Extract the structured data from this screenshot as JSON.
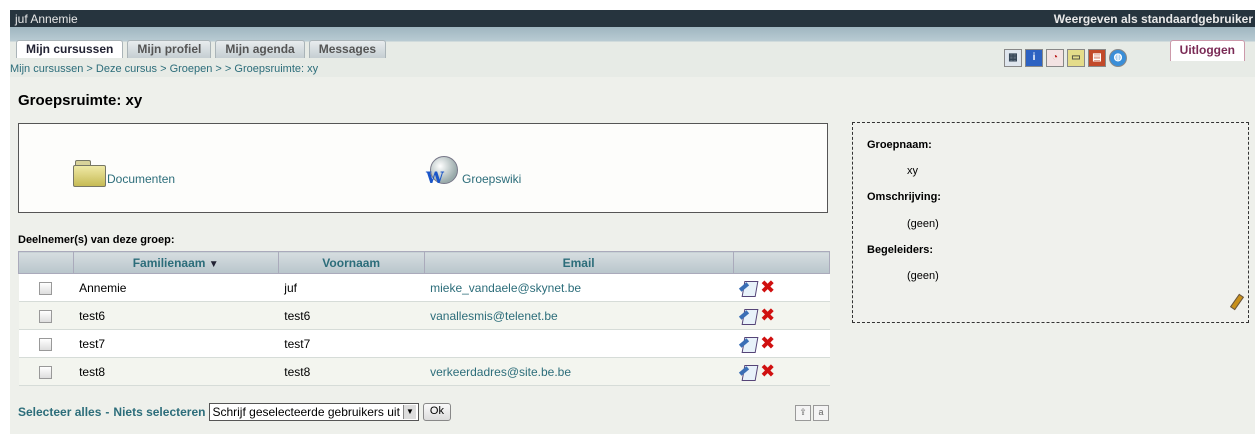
{
  "topbar": {
    "user": "juf Annemie",
    "view_as": "Weergeven als standaardgebruiker"
  },
  "tabs": [
    {
      "label": "Mijn cursussen",
      "active": true
    },
    {
      "label": "Mijn profiel",
      "active": false
    },
    {
      "label": "Mijn agenda",
      "active": false
    },
    {
      "label": "Messages",
      "active": false
    }
  ],
  "breadcrumb": "Mijn cursussen > Deze cursus > Groepen > > Groepsruimte: xy",
  "logout_label": "Uitloggen",
  "tool_icons": [
    "calendar-icon",
    "info-icon",
    "agenda-icon",
    "folder-icon",
    "notes-icon",
    "globe-icon"
  ],
  "page_title": "Groepsruimte: xy",
  "tools": {
    "documents": "Documenten",
    "wiki": "Groepswiki",
    "wiki_badge": "W"
  },
  "members_label": "Deelnemer(s) van deze groep:",
  "table": {
    "headers": {
      "lastname": "Familienaam",
      "sort_marker": "▼",
      "firstname": "Voornaam",
      "email": "Email"
    },
    "rows": [
      {
        "lastname": "Annemie",
        "firstname": "juf",
        "email": "mieke_vandaele@skynet.be"
      },
      {
        "lastname": "test6",
        "firstname": "test6",
        "email": "vanallesmis@telenet.be"
      },
      {
        "lastname": "test7",
        "firstname": "test7",
        "email": ""
      },
      {
        "lastname": "test8",
        "firstname": "test8",
        "email": "verkeerdadres@site.be.be"
      }
    ]
  },
  "bottom": {
    "select_all": "Selecteer alles",
    "separator": "-",
    "select_none": "Niets selecteren",
    "action_selected": "Schrijf geselecteerde gebruikers uit",
    "ok": "Ok"
  },
  "sidebox": {
    "group_name_label": "Groepnaam:",
    "group_name": "xy",
    "description_label": "Omschrijving:",
    "description": "(geen)",
    "tutors_label": "Begeleiders:",
    "tutors": "(geen)"
  },
  "colors": {
    "topbar": "#26343e",
    "link": "#2c6d7a",
    "delete": "#d01010",
    "logout": "#7a2a55"
  }
}
